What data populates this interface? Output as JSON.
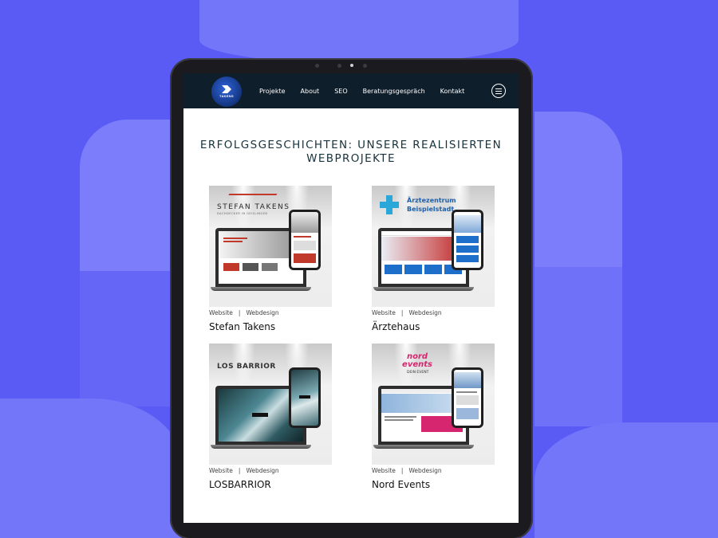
{
  "nav": {
    "logo_text": "TAKENS",
    "links": [
      "Projekte",
      "About",
      "SEO",
      "Beratungsgespräch",
      "Kontakt"
    ]
  },
  "page": {
    "title_line1": "ERFOLGSGESCHICHTEN: UNSERE REALISIERTEN",
    "title_line2": "WEBPROJEKTE"
  },
  "projects": [
    {
      "title": "Stefan Takens",
      "tag1": "Website",
      "tag2": "Webdesign",
      "separator": "|",
      "brand": "STEFAN TAKENS",
      "brand_sub": "DACHDECKER IN GEISLINGEN"
    },
    {
      "title": "Ärztehaus",
      "tag1": "Website",
      "tag2": "Webdesign",
      "separator": "|",
      "brand": "Ärztezentrum",
      "brand_sub": "Beispielstadt"
    },
    {
      "title": "LOSBARRIOR",
      "tag1": "Website",
      "tag2": "Webdesign",
      "separator": "|",
      "brand": "LOS BARRIOR",
      "brand_sub": ""
    },
    {
      "title": "Nord Events",
      "tag1": "Website",
      "tag2": "Webdesign",
      "separator": "|",
      "brand": "nord events",
      "brand_sub": "DEIN EVENT"
    }
  ],
  "colors": {
    "background": "#5a5af5",
    "nav": "#0f1e2b",
    "title": "#17323c"
  }
}
